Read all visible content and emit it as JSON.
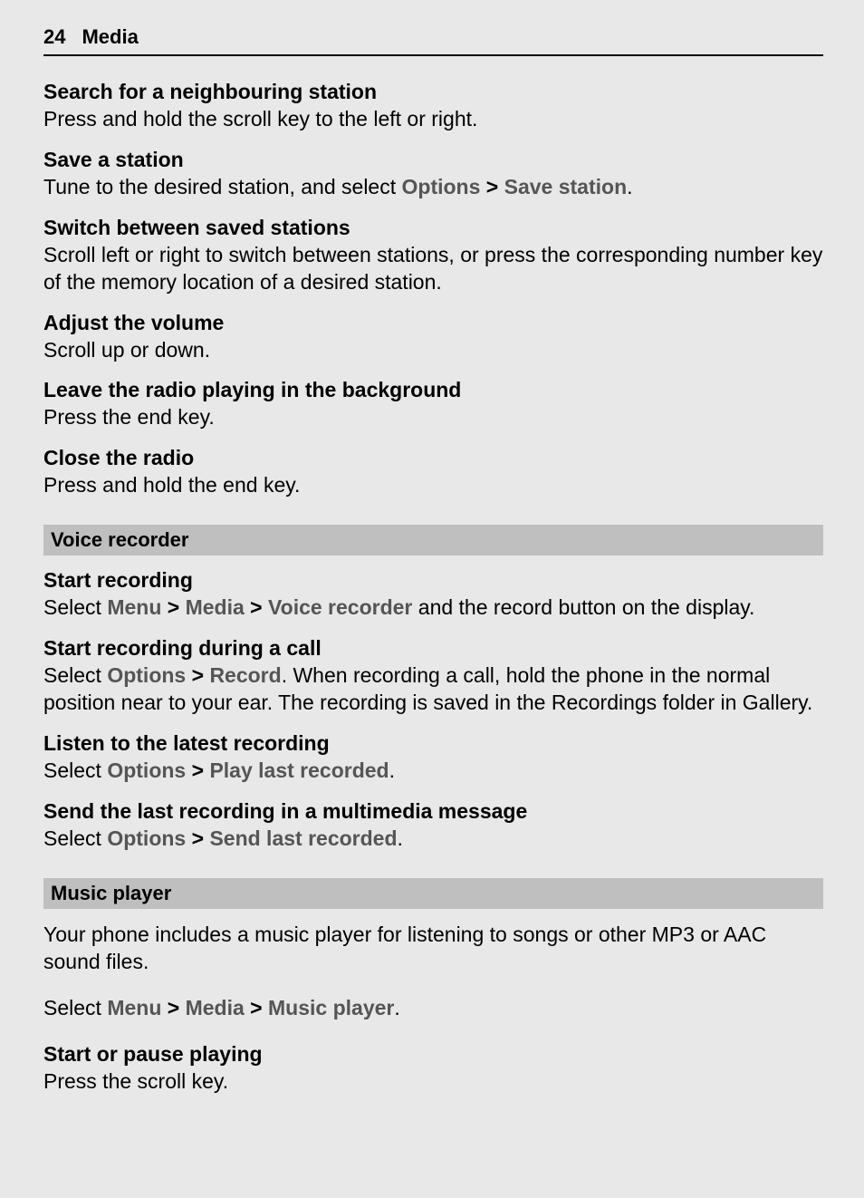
{
  "header": {
    "page_number": "24",
    "title": "Media"
  },
  "radio": {
    "search": {
      "title": "Search for a neighbouring station",
      "body": "Press and hold the scroll key to the left or right."
    },
    "save": {
      "title": "Save a station",
      "body_pre": "Tune to the desired station, and select ",
      "bold1": "Options",
      "sep1": " > ",
      "bold2": "Save station",
      "body_post": "."
    },
    "switch": {
      "title": "Switch between saved stations",
      "body": "Scroll left or right to switch between stations, or press the corresponding number key of the memory location of a desired station."
    },
    "volume": {
      "title": "Adjust the volume",
      "body": "Scroll up or down."
    },
    "background": {
      "title": "Leave the radio playing in the background",
      "body": "Press the end key."
    },
    "close": {
      "title": "Close the radio",
      "body": "Press and hold the end key."
    }
  },
  "voice": {
    "heading": "Voice recorder",
    "start": {
      "title": "Start recording",
      "pre": "Select ",
      "b1": "Menu",
      "s1": " > ",
      "b2": "Media",
      "s2": " > ",
      "b3": "Voice recorder",
      "post": " and the record button on the display."
    },
    "during_call": {
      "title": "Start recording during a call",
      "pre": "Select ",
      "b1": "Options",
      "s1": " > ",
      "b2": "Record",
      "post": ". When recording a call, hold the phone in the normal position near to your ear. The recording is saved in the Recordings folder in Gallery."
    },
    "listen": {
      "title": "Listen to the latest recording",
      "pre": "Select ",
      "b1": "Options",
      "s1": " > ",
      "b2": "Play last recorded",
      "post": "."
    },
    "send": {
      "title": "Send the last recording in a multimedia message",
      "pre": "Select ",
      "b1": "Options",
      "s1": " > ",
      "b2": "Send last recorded",
      "post": "."
    }
  },
  "music": {
    "heading": "Music player",
    "intro": "Your phone includes a music player for listening to songs or other MP3 or AAC sound files.",
    "nav_pre": "Select ",
    "nav_b1": "Menu",
    "nav_s1": " > ",
    "nav_b2": "Media",
    "nav_s2": " > ",
    "nav_b3": "Music player",
    "nav_post": ".",
    "play": {
      "title": "Start or pause playing",
      "body": "Press the scroll key."
    }
  }
}
